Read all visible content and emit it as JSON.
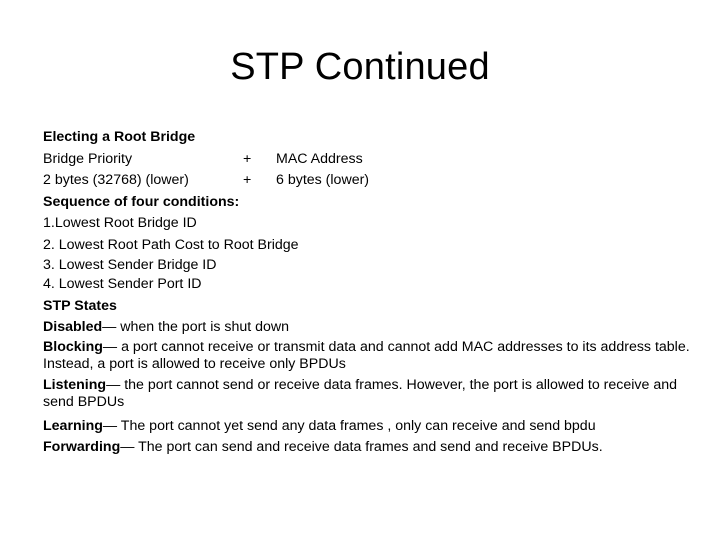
{
  "slide": {
    "title": "STP Continued",
    "electing_heading": "Electing a Root Bridge",
    "bridge_id_table": {
      "row1": {
        "left": "Bridge Priority",
        "operator": "+",
        "right": "MAC Address"
      },
      "row2": {
        "left": "2 bytes  (32768) (lower)",
        "operator": "+",
        "right": "6 bytes (lower)"
      }
    },
    "conditions_heading": "Sequence of four conditions:",
    "conditions": [
      "1.Lowest Root Bridge ID",
      "2. Lowest Root Path Cost to Root Bridge",
      "3. Lowest Sender Bridge ID",
      "4. Lowest Sender Port ID"
    ],
    "states_heading": "STP States",
    "states": [
      {
        "name": "Disabled",
        "separator": "— ",
        "description": "when the port is shut down"
      },
      {
        "name": "Blocking",
        "separator": "— ",
        "description": "a port cannot receive or transmit data and cannot add MAC addresses to its address table. Instead, a port is allowed to receive only BPDUs"
      },
      {
        "name": "Listening",
        "separator": "— ",
        "description": "the port cannot send or receive data frames. However, the port is allowed to receive and send BPDUs"
      },
      {
        "name": "Learning",
        "separator": "— ",
        "description": "The port cannot yet send any data frames , only can receive and send bpdu"
      },
      {
        "name": "Forwarding",
        "separator": "— ",
        "description": "The port can send and receive data frames and send and receive BPDUs."
      }
    ]
  }
}
